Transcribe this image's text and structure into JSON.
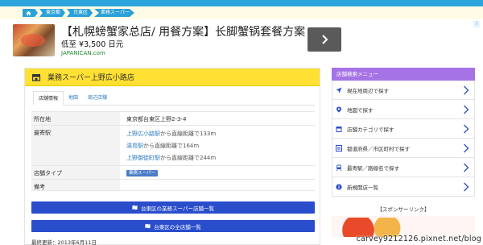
{
  "breadcrumb": {
    "items": [
      "東京都",
      "台東区",
      "業務スーパー"
    ]
  },
  "ad": {
    "title": "【札幌螃蟹家总店/ 用餐方案】长脚蟹锅套餐方案",
    "price": "低至 ¥3,500 日元",
    "domain": "JAPANICAN.com"
  },
  "store": {
    "title": "業務スーパー上野広小路店",
    "tabs": [
      "店舗情報",
      "地図",
      "周辺店舗"
    ],
    "address_label": "所在地",
    "address": "東京都台東区上野2-3-4",
    "station_label": "最寄駅",
    "stations": [
      {
        "name": "上野広小路駅",
        "rest": "から直線距離で133m"
      },
      {
        "name": "湯島駅",
        "rest": "から直線距離で164m"
      },
      {
        "name": "上野御徒町駅",
        "rest": "から直線距離で244m"
      }
    ],
    "type_label": "店舗タイプ",
    "type_badge": "業務スーパー",
    "note_label": "備考",
    "button1": "台東区の業務スーパー店舗一覧",
    "button2": "台東区の全店舗一覧",
    "updated": "最終更新：2013年6月11日"
  },
  "sidebar": {
    "header": "店舗検索メニュー",
    "items": [
      {
        "label": "現在地周辺で探す",
        "icon": "location-arrow-icon"
      },
      {
        "label": "地図で探す",
        "icon": "map-pin-icon"
      },
      {
        "label": "店舗カテゴリで探す",
        "icon": "store-icon"
      },
      {
        "label": "都道府県／市区町村で探す",
        "icon": "list-icon"
      },
      {
        "label": "最寄駅／路線名で探す",
        "icon": "train-icon"
      },
      {
        "label": "新規開店一覧",
        "icon": "info-icon"
      }
    ],
    "sponsor": "【スポンサーリンク】"
  },
  "watermark": "carvey9212126.pixnet.net/blog",
  "colors": {
    "breadcrumb": "#2aa1d9",
    "header_yellow": "#ffe033",
    "button_blue": "#2a4dcc",
    "sidebar_purple": "#a673e6"
  }
}
